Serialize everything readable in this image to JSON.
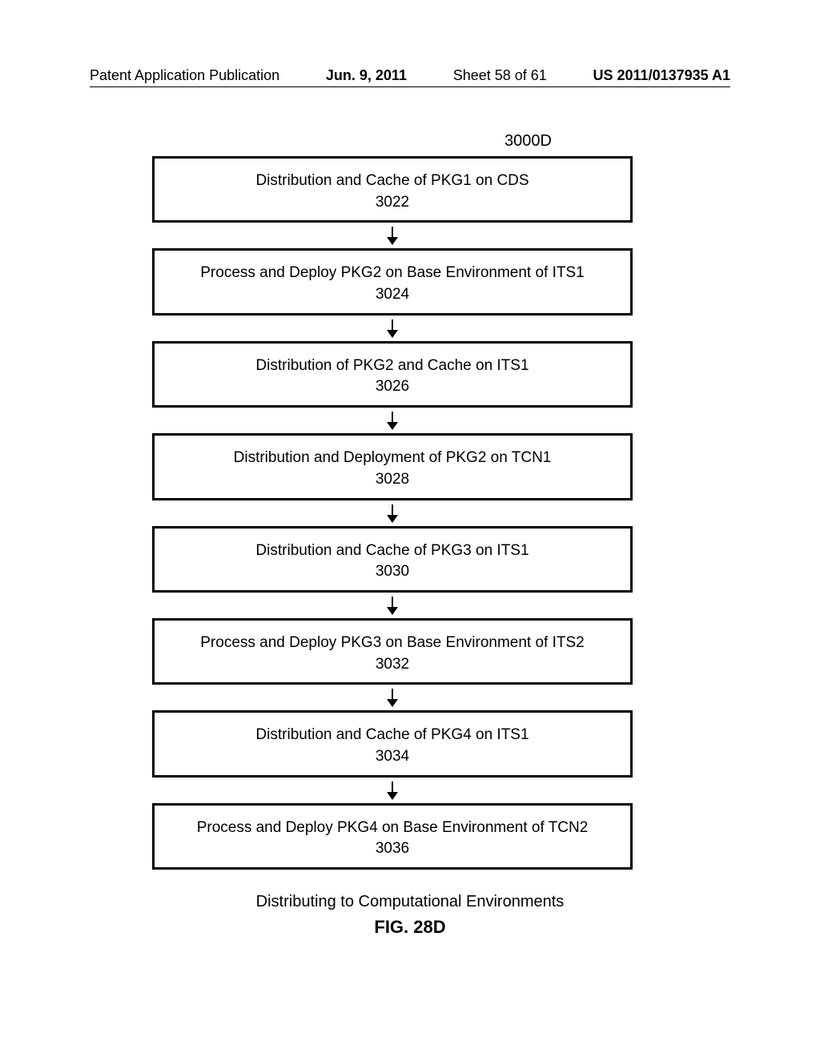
{
  "header": {
    "publication_type": "Patent Application Publication",
    "date": "Jun. 9, 2011",
    "sheet": "Sheet 58 of 61",
    "pubnum": "US 2011/0137935 A1"
  },
  "figure_id": "3000D",
  "steps": [
    {
      "text": "Distribution and Cache of PKG1 on CDS",
      "ref": "3022"
    },
    {
      "text": "Process and Deploy PKG2 on Base Environment of ITS1",
      "ref": "3024"
    },
    {
      "text": "Distribution of PKG2 and Cache on ITS1",
      "ref": "3026"
    },
    {
      "text": "Distribution and Deployment of PKG2 on TCN1",
      "ref": "3028"
    },
    {
      "text": "Distribution and Cache of PKG3 on ITS1",
      "ref": "3030"
    },
    {
      "text": "Process and Deploy PKG3 on Base Environment of ITS2",
      "ref": "3032"
    },
    {
      "text": "Distribution and Cache of PKG4 on ITS1",
      "ref": "3034"
    },
    {
      "text": "Process and Deploy PKG4 on Base Environment of TCN2",
      "ref": "3036"
    }
  ],
  "caption": "Distributing to Computational Environments",
  "figure_label": "FIG. 28D"
}
